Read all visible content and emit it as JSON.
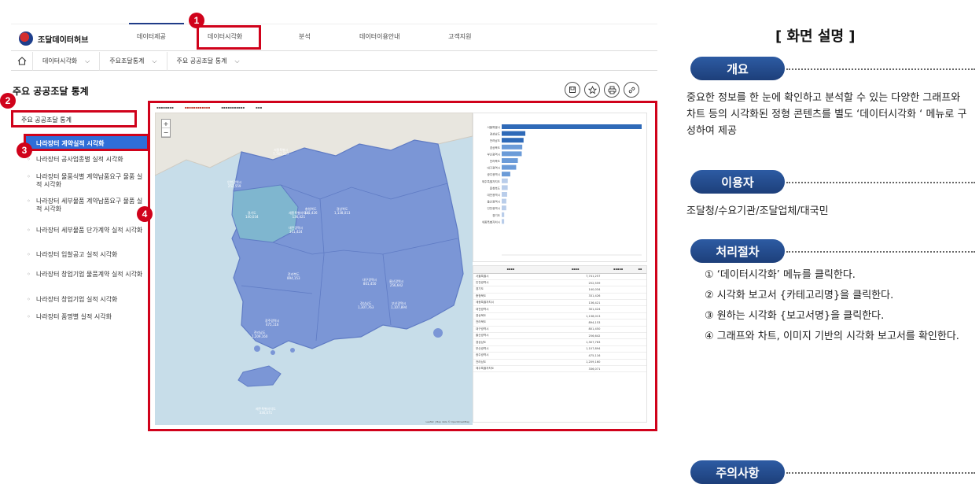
{
  "screen": {
    "logo_text": "조달데이터허브",
    "nav_items": [
      "데이터제공",
      "데이터시각화",
      "분석",
      "데이터이용안내",
      "고객지원"
    ],
    "breadcrumb": [
      "데이터시각화",
      "주요조달통계",
      "주요 공공조달 통계"
    ],
    "page_title": "주요 공공조달 통계",
    "tool_icons": [
      "bookmark-icon",
      "star-icon",
      "print-icon",
      "link-icon"
    ],
    "sidebar": {
      "header": "주요 공공조달 통계",
      "active": "나라장터 계약실적 시각화",
      "items": [
        "나라장터 공사업종별 실적 시각화",
        "나라장터 물품식별 계약납품요구 물품 실적 시각화",
        "나라장터 세부물품 계약납품요구 물품 실적 시각화",
        "나라장터 세부물품 단가계약 실적 시각화",
        "나라장터 입찰공고 실적 시각화",
        "나라장터 창업기업 물품계약 실적 시각화",
        "나라장터 창업기업 실적 시각화",
        "나라장터 품명별 실적 시각화"
      ]
    },
    "markers": [
      "1",
      "2",
      "3",
      "4"
    ],
    "map_zoom": [
      "+",
      "−"
    ],
    "map_labels": [
      {
        "name": "서울특별시",
        "value": "7,741,257"
      },
      {
        "name": "인천광역시",
        "value": "252,559"
      },
      {
        "name": "경기도",
        "value": "140,034"
      },
      {
        "name": "충청북도",
        "value": "331,426"
      },
      {
        "name": "세종특별자치시",
        "value": "136,421"
      },
      {
        "name": "대전광역시",
        "value": "301,424"
      },
      {
        "name": "경상북도",
        "value": "1,138,013"
      },
      {
        "name": "전라북도",
        "value": "894,153"
      },
      {
        "name": "대구광역시",
        "value": "801,450"
      },
      {
        "name": "울산광역시",
        "value": "256,642"
      },
      {
        "name": "경상남도",
        "value": "1,307,763"
      },
      {
        "name": "부산광역시",
        "value": "1,107,894"
      },
      {
        "name": "광주광역시",
        "value": "475,116"
      },
      {
        "name": "전라남도",
        "value": "1,209,160"
      },
      {
        "name": "제주특별자치도",
        "value": "336,071"
      }
    ]
  },
  "description": {
    "title": "[ 화면 설명 ]",
    "overview_label": "개요",
    "overview_text": "중요한 정보를 한 눈에 확인하고 분석할 수 있는 다양한 그래프와 차트 등의 시각화된 정형 콘텐츠를 별도 ‘데이터시각화 ‘ 메뉴로 구성하여 제공",
    "users_label": "이용자",
    "users_text": "조달청/수요기관/조달업체/대국민",
    "procedure_label": "처리절차",
    "steps": [
      "① ‘데이터시각화’ 메뉴를 클릭한다.",
      "② 시각화 보고서 {카테고리명}을 클릭한다.",
      "③ 원하는 시각화 {보고서명}을 클릭한다.",
      "④ 그래프와 차트, 이미지 기반의 시각화 보고서를 확인한다."
    ],
    "caution_label": "주의사항"
  },
  "colors": {
    "accent_red": "#d0021b",
    "pill_blue": "#1d3f7a",
    "active_blue": "#2f6ed8",
    "map_blue": "#7b96d6",
    "map_highlight": "#7fb6cf"
  }
}
